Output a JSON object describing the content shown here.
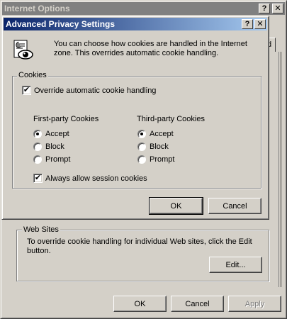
{
  "background_window": {
    "title": "Internet Options",
    "help_glyph": "?",
    "close_glyph": "✕",
    "tab_fragment": "d",
    "web_sites": {
      "group_label": "Web Sites",
      "description": "To override cookie handling for individual Web sites, click the Edit button.",
      "edit_button": "Edit..."
    },
    "buttons": {
      "ok": "OK",
      "cancel": "Cancel",
      "apply": "Apply"
    }
  },
  "dialog": {
    "title": "Advanced Privacy Settings",
    "help_glyph": "?",
    "close_glyph": "✕",
    "description": "You can choose how cookies are handled in the Internet zone. This overrides automatic cookie handling.",
    "cookies_group": {
      "label": "Cookies",
      "override_checkbox": {
        "label": "Override automatic cookie handling",
        "checked": true
      },
      "first_party": {
        "header": "First-party Cookies",
        "options": [
          "Accept",
          "Block",
          "Prompt"
        ],
        "selected": "Accept"
      },
      "third_party": {
        "header": "Third-party Cookies",
        "options": [
          "Accept",
          "Block",
          "Prompt"
        ],
        "selected": "Accept"
      },
      "session_checkbox": {
        "label": "Always allow session cookies",
        "checked": true
      }
    },
    "buttons": {
      "ok": "OK",
      "cancel": "Cancel"
    }
  },
  "colors": {
    "face": "#d4d0c8",
    "active_title_start": "#0a246a",
    "active_title_end": "#a6caf0",
    "inactive_title": "#808080"
  },
  "check_mark": "✔"
}
